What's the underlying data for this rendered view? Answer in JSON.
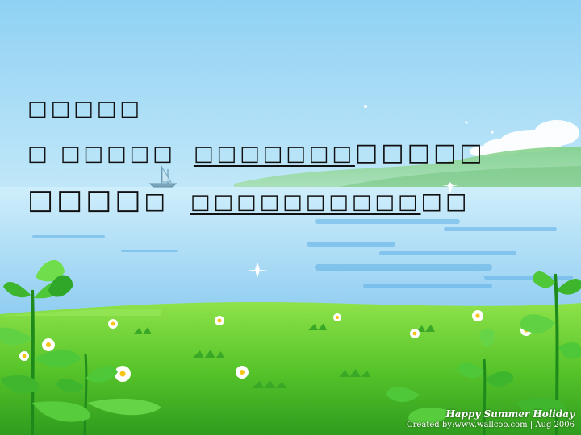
{
  "slide": {
    "line1": "□□□□□",
    "line2_prefix": "□ □□□□□",
    "line2_underlined": "□□□□□□□",
    "line2_suffix": "□□□□□",
    "line3_prefix": "□□□□",
    "line3_small": "□",
    "line3_underlined": "□□□□□□□□□□",
    "line3_suffix": "□□"
  },
  "watermark": {
    "title": "Happy Summer Holiday",
    "credit": "Created by:www.wallcoo.com | Aug 2006"
  },
  "colors": {
    "sky_top": "#96d3f4",
    "sky_bottom": "#d9f1fb",
    "water": "#9fd6f3",
    "water_dark": "#5fb0e6",
    "hill": "#8fcf8a",
    "grass": "#6bd43a",
    "grass_dark": "#2e9a1f",
    "text": "#111111"
  }
}
